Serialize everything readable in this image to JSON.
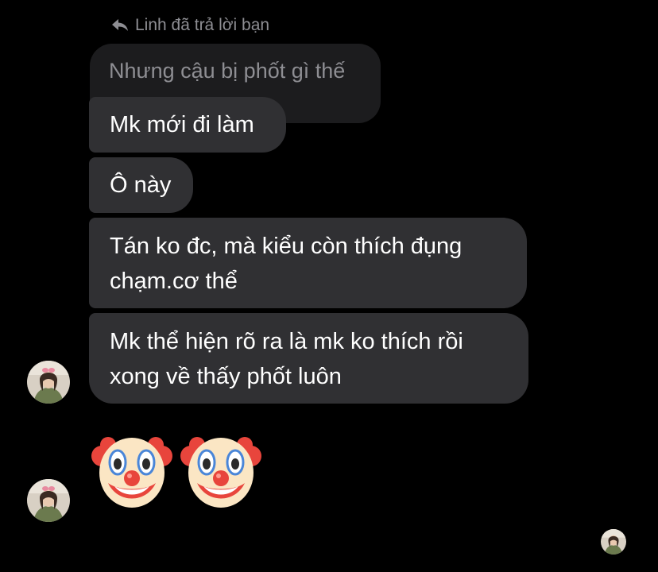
{
  "reply_header": {
    "text": "Linh đã trả lời bạn",
    "icon": "reply-arrow-icon"
  },
  "quoted_message": {
    "text": "Nhưng cậu bị phốt gì thế"
  },
  "messages": [
    {
      "lines": [
        "Mk mới đi làm"
      ]
    },
    {
      "lines": [
        "Ô này"
      ]
    },
    {
      "lines": [
        "Tán ko đc, mà kiểu còn thích đụng",
        "chạm.cơ thể"
      ]
    },
    {
      "lines": [
        "Mk thể hiện rõ ra là mk ko thích rồi",
        "xong về thấy phốt luôn"
      ]
    }
  ],
  "emoji_message": {
    "emojis": [
      "clown-face-icon",
      "clown-face-icon"
    ]
  },
  "colors": {
    "background": "#000000",
    "bubble": "#303033",
    "quoted_bubble": "#1c1c1e",
    "muted_text": "#8e8e93"
  }
}
